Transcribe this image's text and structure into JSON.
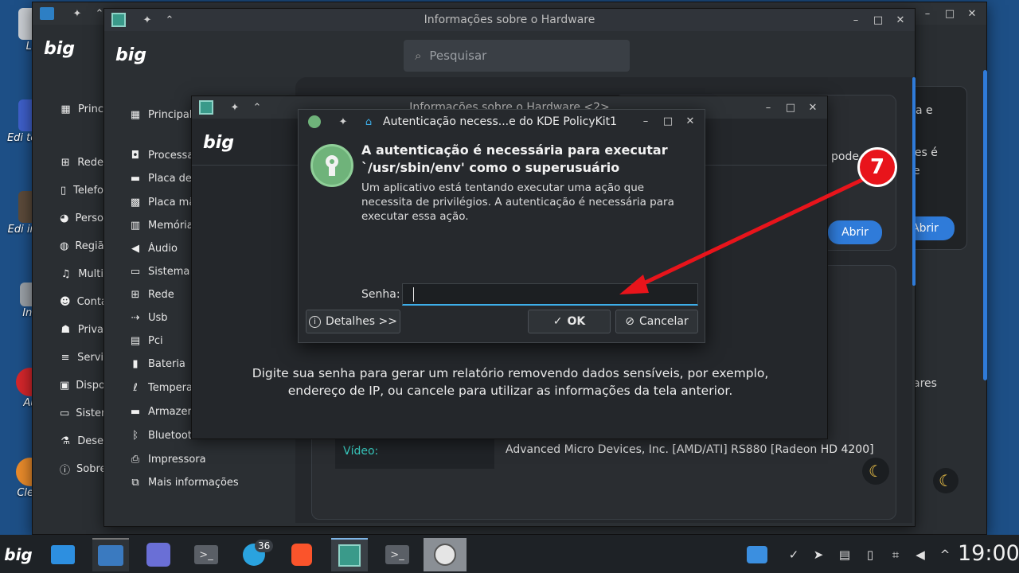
{
  "desktop": {
    "icons": [
      {
        "label": "Li"
      },
      {
        "label": "Edi texto"
      },
      {
        "label": "Edi imag"
      },
      {
        "label": "Ink"
      },
      {
        "label": "Au"
      },
      {
        "label": "Clem"
      }
    ]
  },
  "back_window": {
    "sidebar": [
      {
        "label": "Princ",
        "icon": "grid-icon"
      },
      {
        "label": "Rede",
        "icon": "network-icon"
      },
      {
        "label": "Telefo",
        "icon": "phone-icon"
      },
      {
        "label": "Perso",
        "icon": "palette-icon"
      },
      {
        "label": "Regiã",
        "icon": "globe-icon"
      },
      {
        "label": "Multi",
        "icon": "music-icon"
      },
      {
        "label": "Conta",
        "icon": "users-icon"
      },
      {
        "label": "Priva",
        "icon": "privacy-icon"
      },
      {
        "label": "Servi",
        "icon": "services-icon"
      },
      {
        "label": "Dispo",
        "icon": "device-icon"
      },
      {
        "label": "Sister",
        "icon": "monitor-icon"
      },
      {
        "label": "Dese",
        "icon": "flask-icon"
      },
      {
        "label": "Sobre",
        "icon": "info-icon"
      }
    ],
    "right_text": {
      "line1": "a e",
      "line2": "pes é",
      "line3": "e",
      "button": "Abrir",
      "footer": "ares"
    }
  },
  "hardware_window": {
    "title": "Informações sobre o Hardware",
    "search_placeholder": "Pesquisar",
    "sidebar": [
      {
        "label": "Principal",
        "icon": "grid-icon"
      },
      {
        "label": "Processa",
        "icon": "cpu-icon"
      },
      {
        "label": "Placa de",
        "icon": "card-icon"
      },
      {
        "label": "Placa mã",
        "icon": "board-icon"
      },
      {
        "label": "Memória",
        "icon": "memory-icon"
      },
      {
        "label": "Áudio",
        "icon": "speaker-icon"
      },
      {
        "label": "Sistema",
        "icon": "monitor-icon"
      },
      {
        "label": "Rede",
        "icon": "network-icon"
      },
      {
        "label": "Usb",
        "icon": "usb-icon"
      },
      {
        "label": "Pci",
        "icon": "pci-icon"
      },
      {
        "label": "Bateria",
        "icon": "battery-icon"
      },
      {
        "label": "Tempera",
        "icon": "thermometer-icon"
      },
      {
        "label": "Armazen",
        "icon": "storage-icon"
      },
      {
        "label": "Bluetoot",
        "icon": "bluetooth-icon"
      },
      {
        "label": "Impressora",
        "icon": "printer-icon"
      },
      {
        "label": "Mais informações",
        "icon": "external-icon"
      }
    ],
    "panel_text": "pode s",
    "open_button": "Abrir",
    "video_label": "Vídeo:",
    "video_value": "Advanced Micro Devices, Inc. [AMD/ATI] RS880 [Radeon HD 4200]"
  },
  "report_window": {
    "title": "Informações sobre o Hardware <2>",
    "message": "Digite sua senha para gerar um relatório removendo dados sensíveis, por exemplo, endereço de IP, ou cancele para utilizar as informações da tela anterior."
  },
  "auth_dialog": {
    "title": "Autenticação necess...e do KDE PolicyKit1",
    "heading": "A autenticação é necessária para executar `/usr/sbin/env' como o superusuário",
    "description": "Um aplicativo está tentando executar uma ação que necessita de privilégios. A autenticação é necessária para executar essa ação.",
    "password_label": "Senha:",
    "password_value": "",
    "details_button": "Detalhes >>",
    "ok_button": "OK",
    "cancel_button": "Cancelar"
  },
  "annotation": {
    "step": "7",
    "color": "#e8141b"
  },
  "taskbar": {
    "telegram_badge": "36",
    "clock": "19:00"
  },
  "colors": {
    "accent": "#2f7bd9",
    "dialog_bg": "#26292d",
    "window_bg": "#2a2e32"
  }
}
